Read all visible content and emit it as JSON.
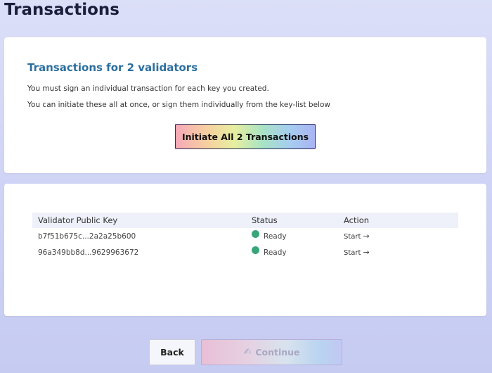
{
  "page": {
    "title": "Transactions"
  },
  "summary": {
    "heading": "Transactions for 2 validators",
    "line1": "You must sign an individual transaction for each key you created.",
    "line2": "You can initiate these all at once, or sign them individually from the key-list below",
    "initiate_label": "Initiate All 2 Transactions"
  },
  "table": {
    "headers": {
      "key": "Validator Public Key",
      "status": "Status",
      "action": "Action"
    },
    "rows": [
      {
        "key": "b7f51b675c...2a2a25b600",
        "status": "Ready",
        "action": "Start"
      },
      {
        "key": "96a349bb8d...9629963672",
        "status": "Ready",
        "action": "Start"
      }
    ]
  },
  "footer": {
    "back_label": "Back",
    "continue_label": "Continue"
  },
  "icons": {
    "status": "status-dot-icon",
    "action": "arrow-right-icon",
    "continue": "quill-pen-icon"
  },
  "colors": {
    "status_ready": "#3aa57a",
    "heading": "#2c6f9e"
  }
}
